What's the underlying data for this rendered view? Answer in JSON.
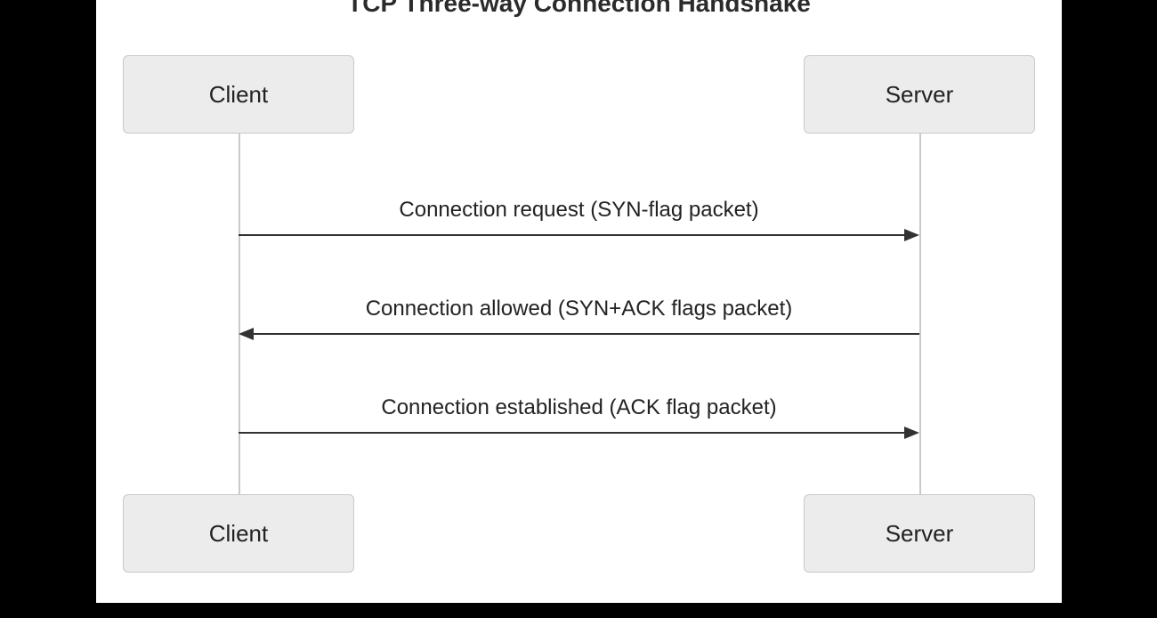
{
  "title": "TCP Three-way Connection Handshake",
  "actors": {
    "left": {
      "label": "Client"
    },
    "right": {
      "label": "Server"
    }
  },
  "messages": {
    "m1": {
      "from": "left",
      "to": "right",
      "label": "Connection request (SYN-flag packet)"
    },
    "m2": {
      "from": "right",
      "to": "left",
      "label": "Connection allowed (SYN+ACK flags packet)"
    },
    "m3": {
      "from": "left",
      "to": "right",
      "label": "Connection established (ACK flag packet)"
    }
  }
}
